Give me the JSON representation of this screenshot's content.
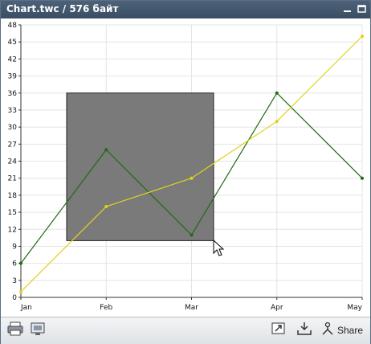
{
  "window": {
    "title": "Chart.twc / 576 байт"
  },
  "toolbar": {
    "print_icon": "printer-icon",
    "image_icon": "image-icon",
    "export_icon": "export-icon",
    "download_icon": "download-icon",
    "share_icon": "share-icon",
    "share_label": "Share"
  },
  "chart_data": {
    "type": "line",
    "categories": [
      "Jan",
      "Feb",
      "Mar",
      "Apr",
      "May"
    ],
    "ylim": [
      0,
      48
    ],
    "yticks": [
      0,
      3,
      6,
      9,
      12,
      15,
      18,
      21,
      24,
      27,
      30,
      33,
      36,
      39,
      42,
      45,
      48
    ],
    "grid": true,
    "series": [
      {
        "color": "#1f6b12",
        "values": [
          6,
          26,
          11,
          36,
          21
        ]
      },
      {
        "color": "#e0d21a",
        "values": [
          1,
          16,
          21,
          31,
          46
        ]
      }
    ],
    "selection_box_color": "#7a7a7a"
  }
}
